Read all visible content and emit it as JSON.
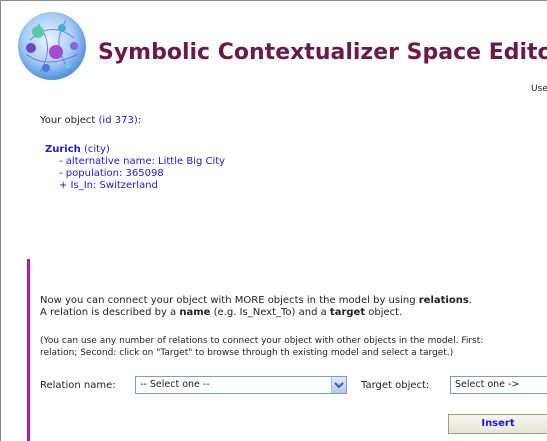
{
  "header": {
    "title": "Symbolic Contextualizer Space Editor",
    "user_link": "Use"
  },
  "object_section": {
    "your_object_label": "Your object",
    "object_id": "(id 373)",
    "object_id_suffix": ":",
    "object_name": "Zurich",
    "object_type": "(city)",
    "properties": [
      "- alternative name: Little Big City",
      "- population: 365098",
      "+ Is_In: Switzerland"
    ]
  },
  "relations_section": {
    "intro_pre": "Now you can connect your object with MORE objects in the model by using ",
    "intro_bold": "relations",
    "intro_post": ".",
    "desc_pre": "A relation is described by a ",
    "desc_name": "name",
    "desc_mid": " (e.g. Is_Next_To) and a ",
    "desc_target": "target",
    "desc_post": " object.",
    "hint_line1": "(You can use any number of relations to connect your object with other objects in the model. First:",
    "hint_line2": "relation; Second: click on \"Target\" to browse through th existing model and select a target.)",
    "relation_name_label": "Relation name:",
    "relation_select_value": "-- Select one --",
    "target_object_label": "Target object:",
    "target_select_value": "Select one ->",
    "insert_label": "Insert"
  },
  "colors": {
    "title": "#6b1a45",
    "link": "#1a1ad6",
    "accent_bar": "#c2179b"
  },
  "icons": {
    "logo": "network-sphere-logo",
    "dropdown": "chevron-down-icon"
  }
}
